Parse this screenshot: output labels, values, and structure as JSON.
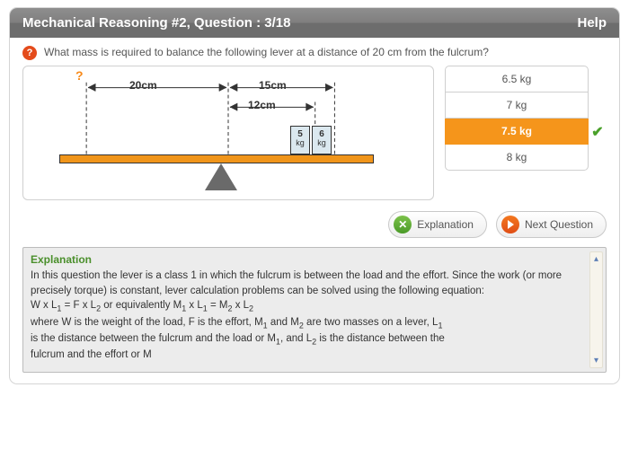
{
  "header": {
    "title": "Mechanical Reasoning #2, Question : 3/18",
    "help": "Help"
  },
  "question": {
    "text": "What mass is required to balance the following lever at a distance of 20 cm from the fulcrum?"
  },
  "diagram": {
    "unknown_marker": "?",
    "dist_left": "20cm",
    "dist_right_outer": "15cm",
    "dist_right_inner": "12cm",
    "block1_value": "5",
    "block1_unit": "kg",
    "block2_value": "6",
    "block2_unit": "kg"
  },
  "answers": {
    "options": [
      "6.5 kg",
      "7 kg",
      "7.5 kg",
      "8 kg"
    ],
    "selected_index": 2,
    "correct": true
  },
  "actions": {
    "explanation": "Explanation",
    "next": "Next Question"
  },
  "explanation": {
    "heading": "Explanation",
    "line1": "In this question the lever is a class 1 in which the fulcrum is between the load and the effort. Since the work (or more precisely torque) is constant, lever calculation problems can be solved using the following equation:",
    "eq_part1": "W x L",
    "eq_part2": " = F x L",
    "eq_part3": " or equivalently M",
    "eq_part4": " x L",
    "eq_part5": " = M",
    "eq_part6": " x L",
    "line3a": "where W is the weight of the load, F is the effort, M",
    "line3b": " and M",
    "line3c": " are two masses on a lever, L",
    "line4a": "is the distance between the fulcrum and the load or M",
    "line4b": ", and L",
    "line4c": " is the distance between the",
    "line5": "fulcrum and the effort or M",
    "s1": "1",
    "s2": "2"
  }
}
